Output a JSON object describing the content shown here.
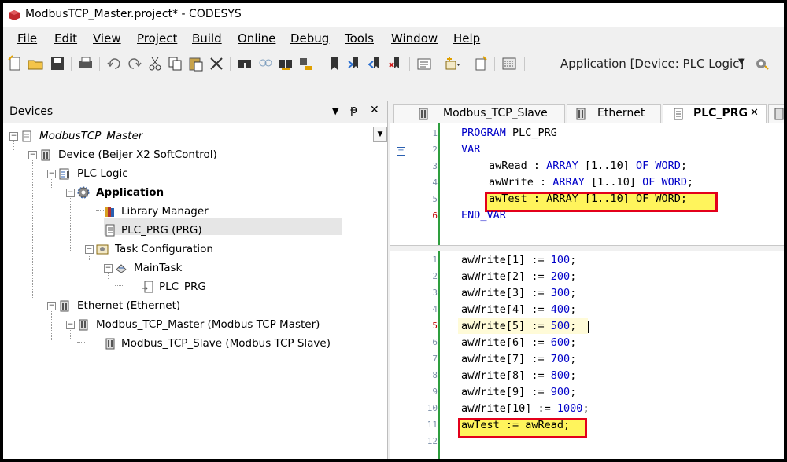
{
  "window": {
    "title": "ModbusTCP_Master.project* - CODESYS"
  },
  "menu": [
    "File",
    "Edit",
    "View",
    "Project",
    "Build",
    "Online",
    "Debug",
    "Tools",
    "Window",
    "Help"
  ],
  "toolbar": {
    "application_combo": "Application [Device: PLC Logic]"
  },
  "devices": {
    "title": "Devices",
    "pin": "ᵽ",
    "close": "✕",
    "tree": [
      {
        "label": "ModbusTCP_Master"
      },
      {
        "label": "Device (Beijer X2 SoftControl)"
      },
      {
        "label": "PLC Logic"
      },
      {
        "label": "Application"
      },
      {
        "label": "Library Manager"
      },
      {
        "label": "PLC_PRG (PRG)"
      },
      {
        "label": "Task Configuration"
      },
      {
        "label": "MainTask"
      },
      {
        "label": "PLC_PRG"
      },
      {
        "label": "Ethernet (Ethernet)"
      },
      {
        "label": "Modbus_TCP_Master (Modbus TCP Master)"
      },
      {
        "label": "Modbus_TCP_Slave (Modbus TCP Slave)"
      }
    ]
  },
  "editor": {
    "tabs": [
      {
        "label": "Modbus_TCP_Slave"
      },
      {
        "label": "Ethernet"
      },
      {
        "label": "PLC_PRG"
      }
    ],
    "tab_close": "✕",
    "decl_lines": [
      "1",
      "2",
      "3",
      "4",
      "5",
      "6"
    ],
    "decl_code": {
      "l1_kw": "PROGRAM",
      "l1_rest": " PLC_PRG",
      "l2_kw": "VAR",
      "l3_a": "awRead : ",
      "l3_b": "ARRAY",
      "l3_c": " [1..10] ",
      "l3_d": "OF WORD",
      "l3_e": ";",
      "l4_a": "awWrite : ",
      "l4_b": "ARRAY",
      "l4_c": " [1..10] ",
      "l4_d": "OF WORD",
      "l4_e": ";",
      "l5_a": "awTest : ",
      "l5_b": "ARRAY",
      "l5_c": " [1..10] ",
      "l5_d": "OF WORD",
      "l5_e": ";",
      "l6_kw": "END_VAR"
    },
    "impl_lines": [
      "1",
      "2",
      "3",
      "4",
      "5",
      "6",
      "7",
      "8",
      "9",
      "10",
      "11",
      "12"
    ],
    "impl_code": [
      {
        "lhs": "awWrite[1] := ",
        "num": "100",
        "end": ";"
      },
      {
        "lhs": "awWrite[2] := ",
        "num": "200",
        "end": ";"
      },
      {
        "lhs": "awWrite[3] := ",
        "num": "300",
        "end": ";"
      },
      {
        "lhs": "awWrite[4] := ",
        "num": "400",
        "end": ";"
      },
      {
        "lhs": "awWrite[5] := ",
        "num": "500",
        "end": ";"
      },
      {
        "lhs": "awWrite[6] := ",
        "num": "600",
        "end": ";"
      },
      {
        "lhs": "awWrite[7] := ",
        "num": "700",
        "end": ";"
      },
      {
        "lhs": "awWrite[8] := ",
        "num": "800",
        "end": ";"
      },
      {
        "lhs": "awWrite[9] := ",
        "num": "900",
        "end": ";"
      },
      {
        "lhs": "awWrite[10] := ",
        "num": "1000",
        "end": ";"
      },
      {
        "lhs": "awTest := awRead;",
        "num": "",
        "end": ""
      }
    ]
  },
  "colors": {
    "highlight_border": "#e3001b",
    "highlight_fill": "#fff45c",
    "keyword": "#0000c8",
    "gutter_bar": "#2e9e3e"
  }
}
